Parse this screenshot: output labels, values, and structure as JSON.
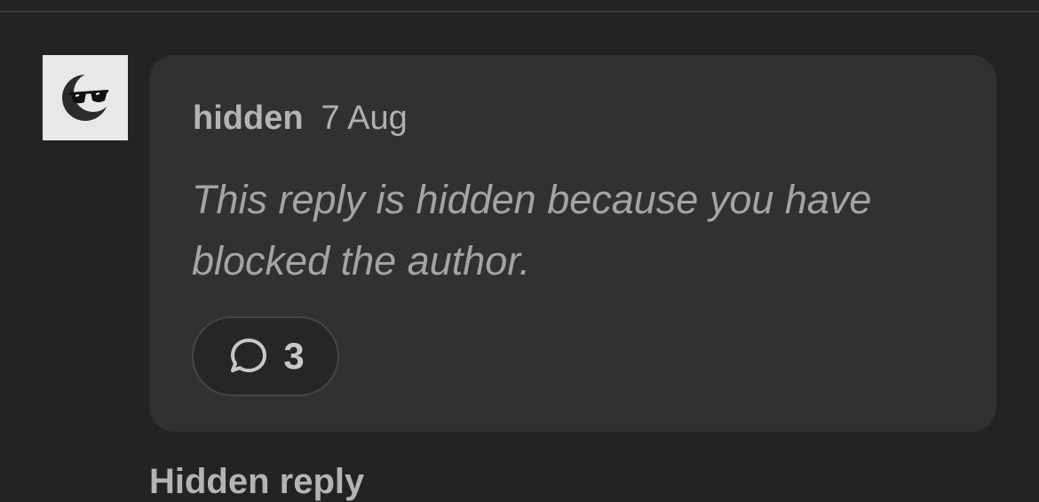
{
  "reply": {
    "author": "hidden",
    "date": "7 Aug",
    "message": "This reply is hidden because you have blocked the author.",
    "reply_count": "3"
  },
  "next_reply": {
    "label": "Hidden reply"
  },
  "icons": {
    "avatar": "sunglasses-moon-avatar-icon",
    "reply": "speech-bubble-icon"
  },
  "colors": {
    "background": "#232323",
    "card": "#313131",
    "muted_text": "#a4a4a4"
  }
}
